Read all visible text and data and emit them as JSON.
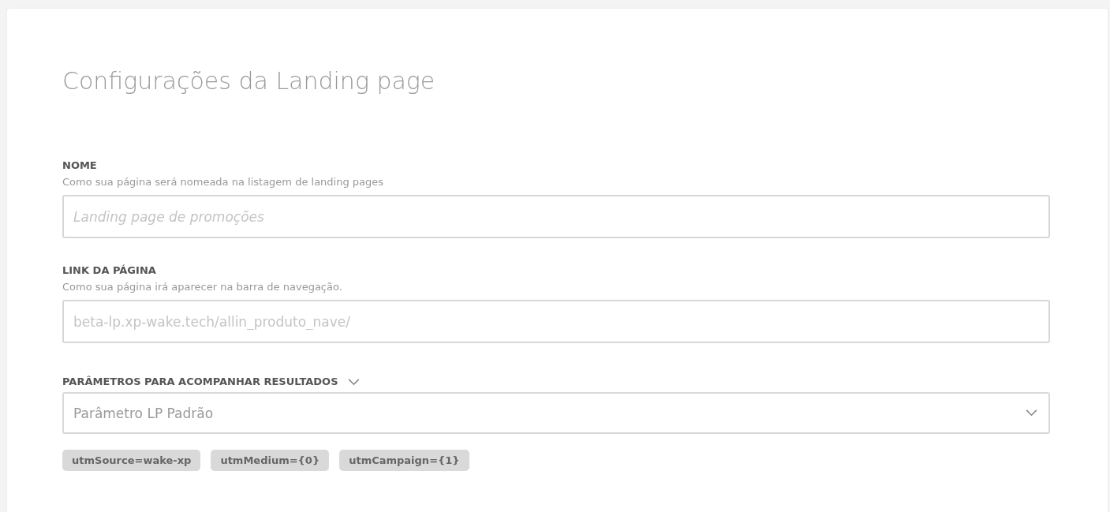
{
  "title": "Configurações da Landing page",
  "fields": [
    {
      "label": "NOME",
      "description": "Como sua página será nomeada na listagem de landing pages",
      "placeholder": "Landing page de promoções",
      "italic": true
    },
    {
      "label": "LINK DA PÁGINA",
      "description": "Como sua página irá aparecer na barra de navegação.",
      "placeholder": "beta-lp.xp-wake.tech/allin_produto_nave/",
      "italic": false
    }
  ],
  "parameters": {
    "label": "PARÂMETROS PARA ACOMPANHAR RESULTADOS",
    "value": "Parâmetro LP Padrão",
    "tags": [
      "utmSource=wake-xp",
      "utmMedium={0}",
      "utmCampaign={1}"
    ]
  }
}
